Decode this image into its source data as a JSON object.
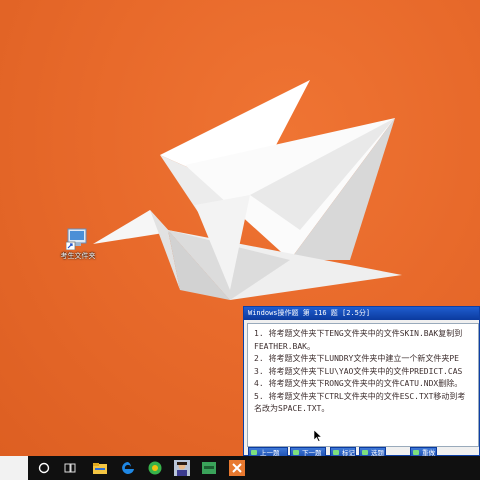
{
  "desktop": {
    "icon_label": "考生文件夹",
    "icon_name": "exam-folder-shortcut-icon"
  },
  "exam_window": {
    "title": "Windows操作题 第 116 题 [2.5分]",
    "lines": [
      "1. 将考题文件夹下TENG文件夹中的文件SKIN.BAK复制到",
      "FEATHER.BAK。",
      "2. 将考题文件夹下LUNDRY文件夹中建立一个新文件夹PE",
      "3. 将考题文件夹下LU\\YAO文件夹中的文件PREDICT.CAS",
      "4. 将考题文件夹下RONG文件夹中的文件CATU.NDX删除。",
      "5. 将考题文件夹下CTRL文件夹中的文件ESC.TXT移动到考",
      "名改为SPACE.TXT。"
    ],
    "buttons": {
      "prev": "上一题",
      "next": "下一题",
      "mark": "标记",
      "select": "选题",
      "redo": "重做"
    }
  },
  "taskbar": {
    "items": [
      "search-box",
      "cortana-icon",
      "task-view-icon",
      "file-explorer-icon",
      "edge-icon",
      "browser-icon",
      "user-avatar-icon",
      "terminal-app-icon",
      "exam-app-icon"
    ]
  },
  "colors": {
    "desktop_bg": "#e56a2c",
    "crane": "#f4f2f0",
    "titlebar": "#1f5dcf",
    "taskbar": "#101010"
  }
}
